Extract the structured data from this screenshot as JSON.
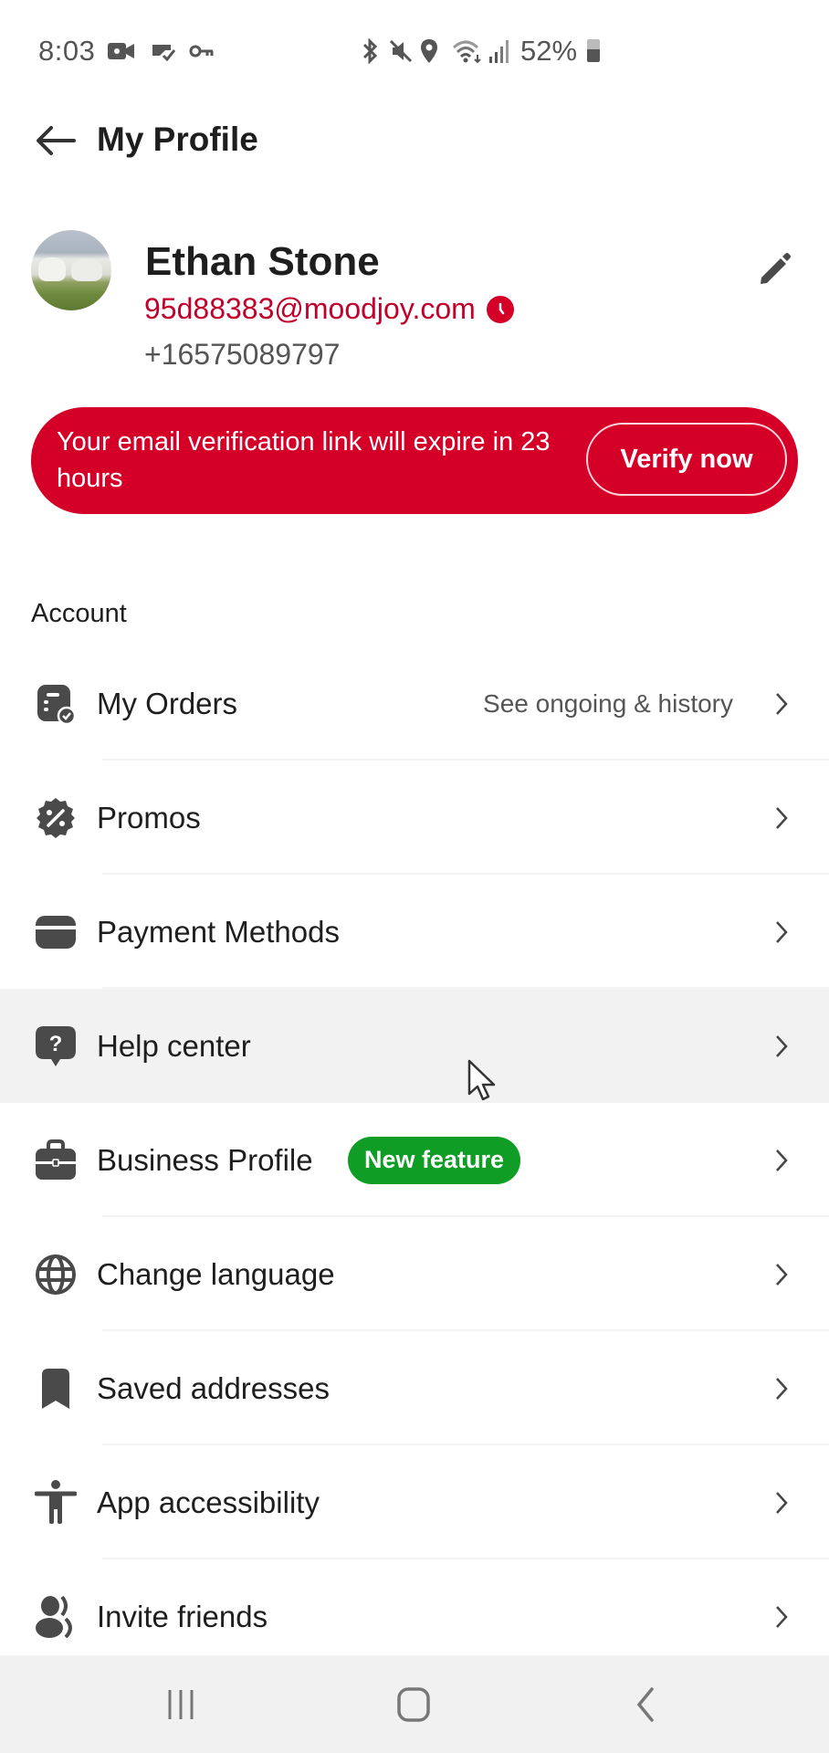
{
  "status_bar": {
    "time": "8:03",
    "battery": "52%",
    "left_icons": [
      "video-call-icon",
      "cast-icon",
      "vpn-key-icon"
    ],
    "right_icons": [
      "bluetooth-icon",
      "mute-icon",
      "location-icon",
      "wifi-icon",
      "signal-icon",
      "battery-icon"
    ]
  },
  "header": {
    "title": "My Profile",
    "back_icon": "arrow-left-icon"
  },
  "profile": {
    "name": "Ethan Stone",
    "email": "95d88383@moodjoy.com",
    "email_status_icon": "clock-pending-icon",
    "phone": "+16575089797",
    "edit_icon": "pencil-icon"
  },
  "verify_banner": {
    "message": "Your email verification link will expire in 23 hours",
    "button_label": "Verify now"
  },
  "colors": {
    "brand_red": "#d50028",
    "email_red": "#c1002b",
    "badge_green": "#0f9d25",
    "hover_bg": "#f2f2f2",
    "nav_bg": "#f1f1f1"
  },
  "account_section": {
    "title": "Account",
    "items": [
      {
        "label": "My Orders",
        "subtext": "See ongoing & history",
        "icon": "orders-icon"
      },
      {
        "label": "Promos",
        "icon": "promo-percent-icon"
      },
      {
        "label": "Payment Methods",
        "icon": "wallet-icon"
      },
      {
        "label": "Help center",
        "icon": "help-bubble-icon",
        "state": "pressed"
      },
      {
        "label": "Business Profile",
        "badge": "New feature",
        "icon": "briefcase-icon"
      },
      {
        "label": "Change language",
        "icon": "globe-icon"
      },
      {
        "label": "Saved addresses",
        "icon": "bookmark-icon"
      },
      {
        "label": "App accessibility",
        "icon": "accessibility-icon"
      },
      {
        "label": "Invite friends",
        "icon": "people-icon"
      }
    ]
  },
  "nav_bar": {
    "buttons": [
      "recent-apps",
      "home",
      "back"
    ]
  }
}
